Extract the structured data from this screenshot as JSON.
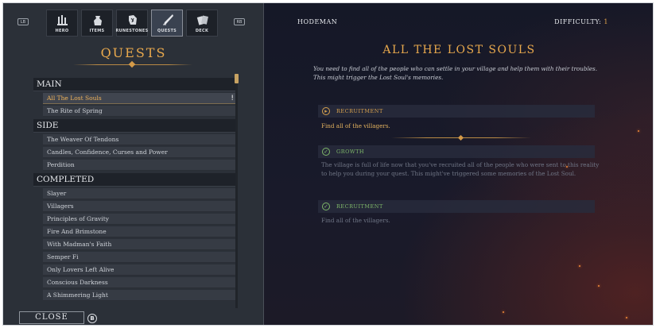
{
  "tabs": [
    {
      "label": "HERO",
      "icon": "hero-icon",
      "active": false
    },
    {
      "label": "ITEMS",
      "icon": "bag-icon",
      "active": false
    },
    {
      "label": "RUNESTONES",
      "icon": "runestone-icon",
      "active": false
    },
    {
      "label": "QUESTS",
      "icon": "quill-icon",
      "active": true
    },
    {
      "label": "DECK",
      "icon": "cards-icon",
      "active": false
    }
  ],
  "nav": {
    "left": "LB",
    "right": "RB"
  },
  "left": {
    "title": "QUESTS",
    "sections": [
      {
        "name": "MAIN",
        "items": [
          {
            "label": "All The Lost Souls",
            "selected": true,
            "flag": "!"
          },
          {
            "label": "The Rite of Spring"
          }
        ]
      },
      {
        "name": "SIDE",
        "items": [
          {
            "label": "The Weaver Of Tendons"
          },
          {
            "label": "Candles, Confidence, Curses and Power"
          },
          {
            "label": "Perdition"
          }
        ]
      },
      {
        "name": "COMPLETED",
        "items": [
          {
            "label": "Slayer"
          },
          {
            "label": "Villagers"
          },
          {
            "label": "Principles of Gravity"
          },
          {
            "label": "Fire And Brimstone"
          },
          {
            "label": "With Madman's Faith"
          },
          {
            "label": "Semper Fi"
          },
          {
            "label": "Only Lovers Left Alive"
          },
          {
            "label": "Conscious Darkness"
          },
          {
            "label": "A Shimmering Light"
          }
        ]
      }
    ],
    "close_label": "CLOSE",
    "close_key": "B"
  },
  "right": {
    "hero_name": "HODEMAN",
    "difficulty_label": "DIFFICULTY:",
    "difficulty_value": "1",
    "quest_title": "ALL THE LOST SOULS",
    "quest_description": "You need to find all of the people who can settle in your village and help them with their troubles. This might trigger the Lost Soul's memories.",
    "objectives": [
      {
        "label": "RECRUITMENT",
        "text": "Find all of the villagers.",
        "state": "active",
        "label_color": "#d8a24e",
        "text_color": "#e3b15e"
      },
      {
        "label": "GROWTH",
        "text": "The village is full of life now that you've recruited all of the people who were sent to this reality to help you during your quest. This might've triggered some memories of the Lost Soul.",
        "state": "done",
        "label_color": "#7fb86a",
        "text_color": "#6f7585"
      },
      {
        "label": "RECRUITMENT",
        "text": "Find all of the villagers.",
        "state": "done",
        "label_color": "#7fb86a",
        "text_color": "#6f7585"
      }
    ]
  },
  "colors": {
    "accent": "#e9a94d",
    "done": "#7fb86a",
    "panel": "#2b3038"
  }
}
